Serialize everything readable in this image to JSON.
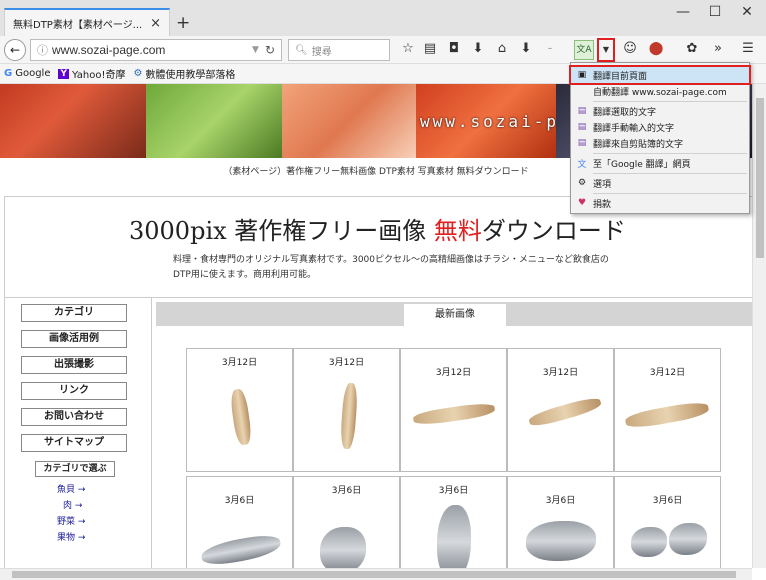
{
  "browser": {
    "tab_title": "無料DTP素材【素材ページ...",
    "tab_close": "×",
    "new_tab": "+",
    "url": "www.sozai-page.com",
    "search_placeholder": "搜尋",
    "window_controls": [
      "—",
      "☐",
      "✕"
    ]
  },
  "bookmarks": [
    {
      "icon": "G",
      "label": "Google"
    },
    {
      "icon": "Y",
      "label": "Yahoo!奇摩"
    },
    {
      "icon": "⚙",
      "label": "數體使用教學部落格"
    }
  ],
  "translate_menu": {
    "items": [
      {
        "icon": "doc-icon",
        "label": "翻譯目前頁面",
        "highlighted": true
      },
      {
        "icon": "",
        "label": "自動翻譯 www.sozai-page.com"
      },
      {
        "icon": "translate-icon",
        "label": "翻譯選取的文字"
      },
      {
        "icon": "translate-icon",
        "label": "翻譯手動輸入的文字"
      },
      {
        "icon": "translate-icon",
        "label": "翻譯來自剪貼簿的文字"
      },
      {
        "icon": "google-translate-icon",
        "label": "至「Google 翻譯」網頁"
      },
      {
        "icon": "gear-icon",
        "label": "選項"
      },
      {
        "icon": "heart-icon",
        "label": "捐款"
      }
    ]
  },
  "page": {
    "banner_text": "www.sozai-p",
    "subtitle": "（素材ページ）著作権フリー無料画像 DTP素材 写真素材 無料ダウンロード",
    "hero_title_before": "3000pix 著作権フリー画像 ",
    "hero_title_free": "無料",
    "hero_title_after": "ダウンロード",
    "hero_desc": "料理・食材専門のオリジナル写真素材です。3000ピクセル～の高精細画像はチラシ・メニューなど飲食店のDTP用に使えます。商用利用可能。",
    "sidebar_buttons": [
      "カテゴリ",
      "画像活用例",
      "出張撮影",
      "リンク",
      "お問い合わせ",
      "サイトマップ"
    ],
    "category_select": "カテゴリで選ぶ",
    "category_links": [
      "魚貝 →",
      "肉 →",
      "野菜 →",
      "果物 →"
    ],
    "latest_tab": "最新画像",
    "row1_dates": [
      "3月12日",
      "3月12日",
      "3月12日",
      "3月12日",
      "3月12日"
    ],
    "row2_dates": [
      "3月6日",
      "3月6日",
      "3月6日",
      "3月6日",
      "3月6日"
    ]
  },
  "colors": {
    "accent_red": "#e02020",
    "tab_blue": "#3a8ee6",
    "menu_highlight": "#cde4f7"
  }
}
